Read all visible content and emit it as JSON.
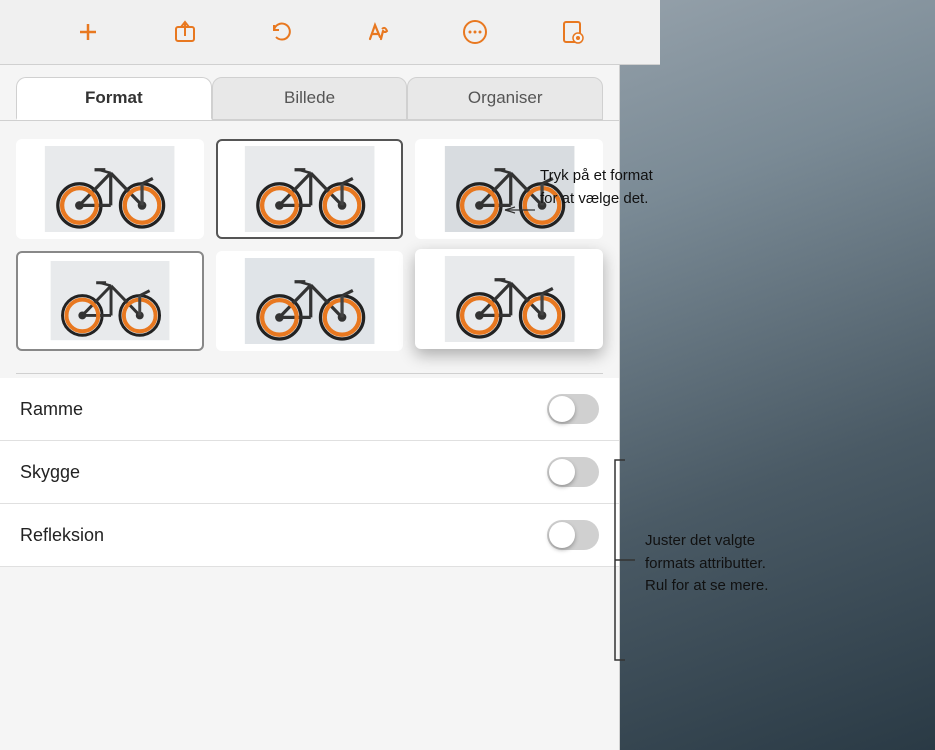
{
  "toolbar": {
    "buttons": [
      {
        "name": "add",
        "icon": "+",
        "label": "Add"
      },
      {
        "name": "share",
        "icon": "↑□",
        "label": "Share"
      },
      {
        "name": "undo",
        "icon": "↺",
        "label": "Undo"
      },
      {
        "name": "paintbrush",
        "icon": "🖌",
        "label": "Format"
      },
      {
        "name": "more",
        "icon": "···",
        "label": "More"
      },
      {
        "name": "document",
        "icon": "📋",
        "label": "Document"
      }
    ]
  },
  "tabs": [
    {
      "id": "format",
      "label": "Format",
      "active": true
    },
    {
      "id": "billede",
      "label": "Billede",
      "active": false
    },
    {
      "id": "organiser",
      "label": "Organiser",
      "active": false
    }
  ],
  "styles": {
    "items": [
      {
        "id": 1,
        "selected": false,
        "lifted": false,
        "frame": false
      },
      {
        "id": 2,
        "selected": true,
        "lifted": false,
        "frame": true
      },
      {
        "id": 3,
        "selected": false,
        "lifted": false,
        "frame": false
      },
      {
        "id": 4,
        "selected": false,
        "lifted": false,
        "frame": true
      },
      {
        "id": 5,
        "selected": false,
        "lifted": false,
        "frame": false
      },
      {
        "id": 6,
        "selected": false,
        "lifted": true,
        "frame": false
      }
    ]
  },
  "toggles": [
    {
      "id": "ramme",
      "label": "Ramme",
      "on": false
    },
    {
      "id": "skygge",
      "label": "Skygge",
      "on": false
    },
    {
      "id": "refleksion",
      "label": "Refleksion",
      "on": false
    }
  ],
  "callouts": {
    "callout1": {
      "text": "Tryk på et format\nfor at vælge det."
    },
    "callout2": {
      "text": "Juster det valgte\nformats attributter.\nRul for at se mere."
    }
  }
}
